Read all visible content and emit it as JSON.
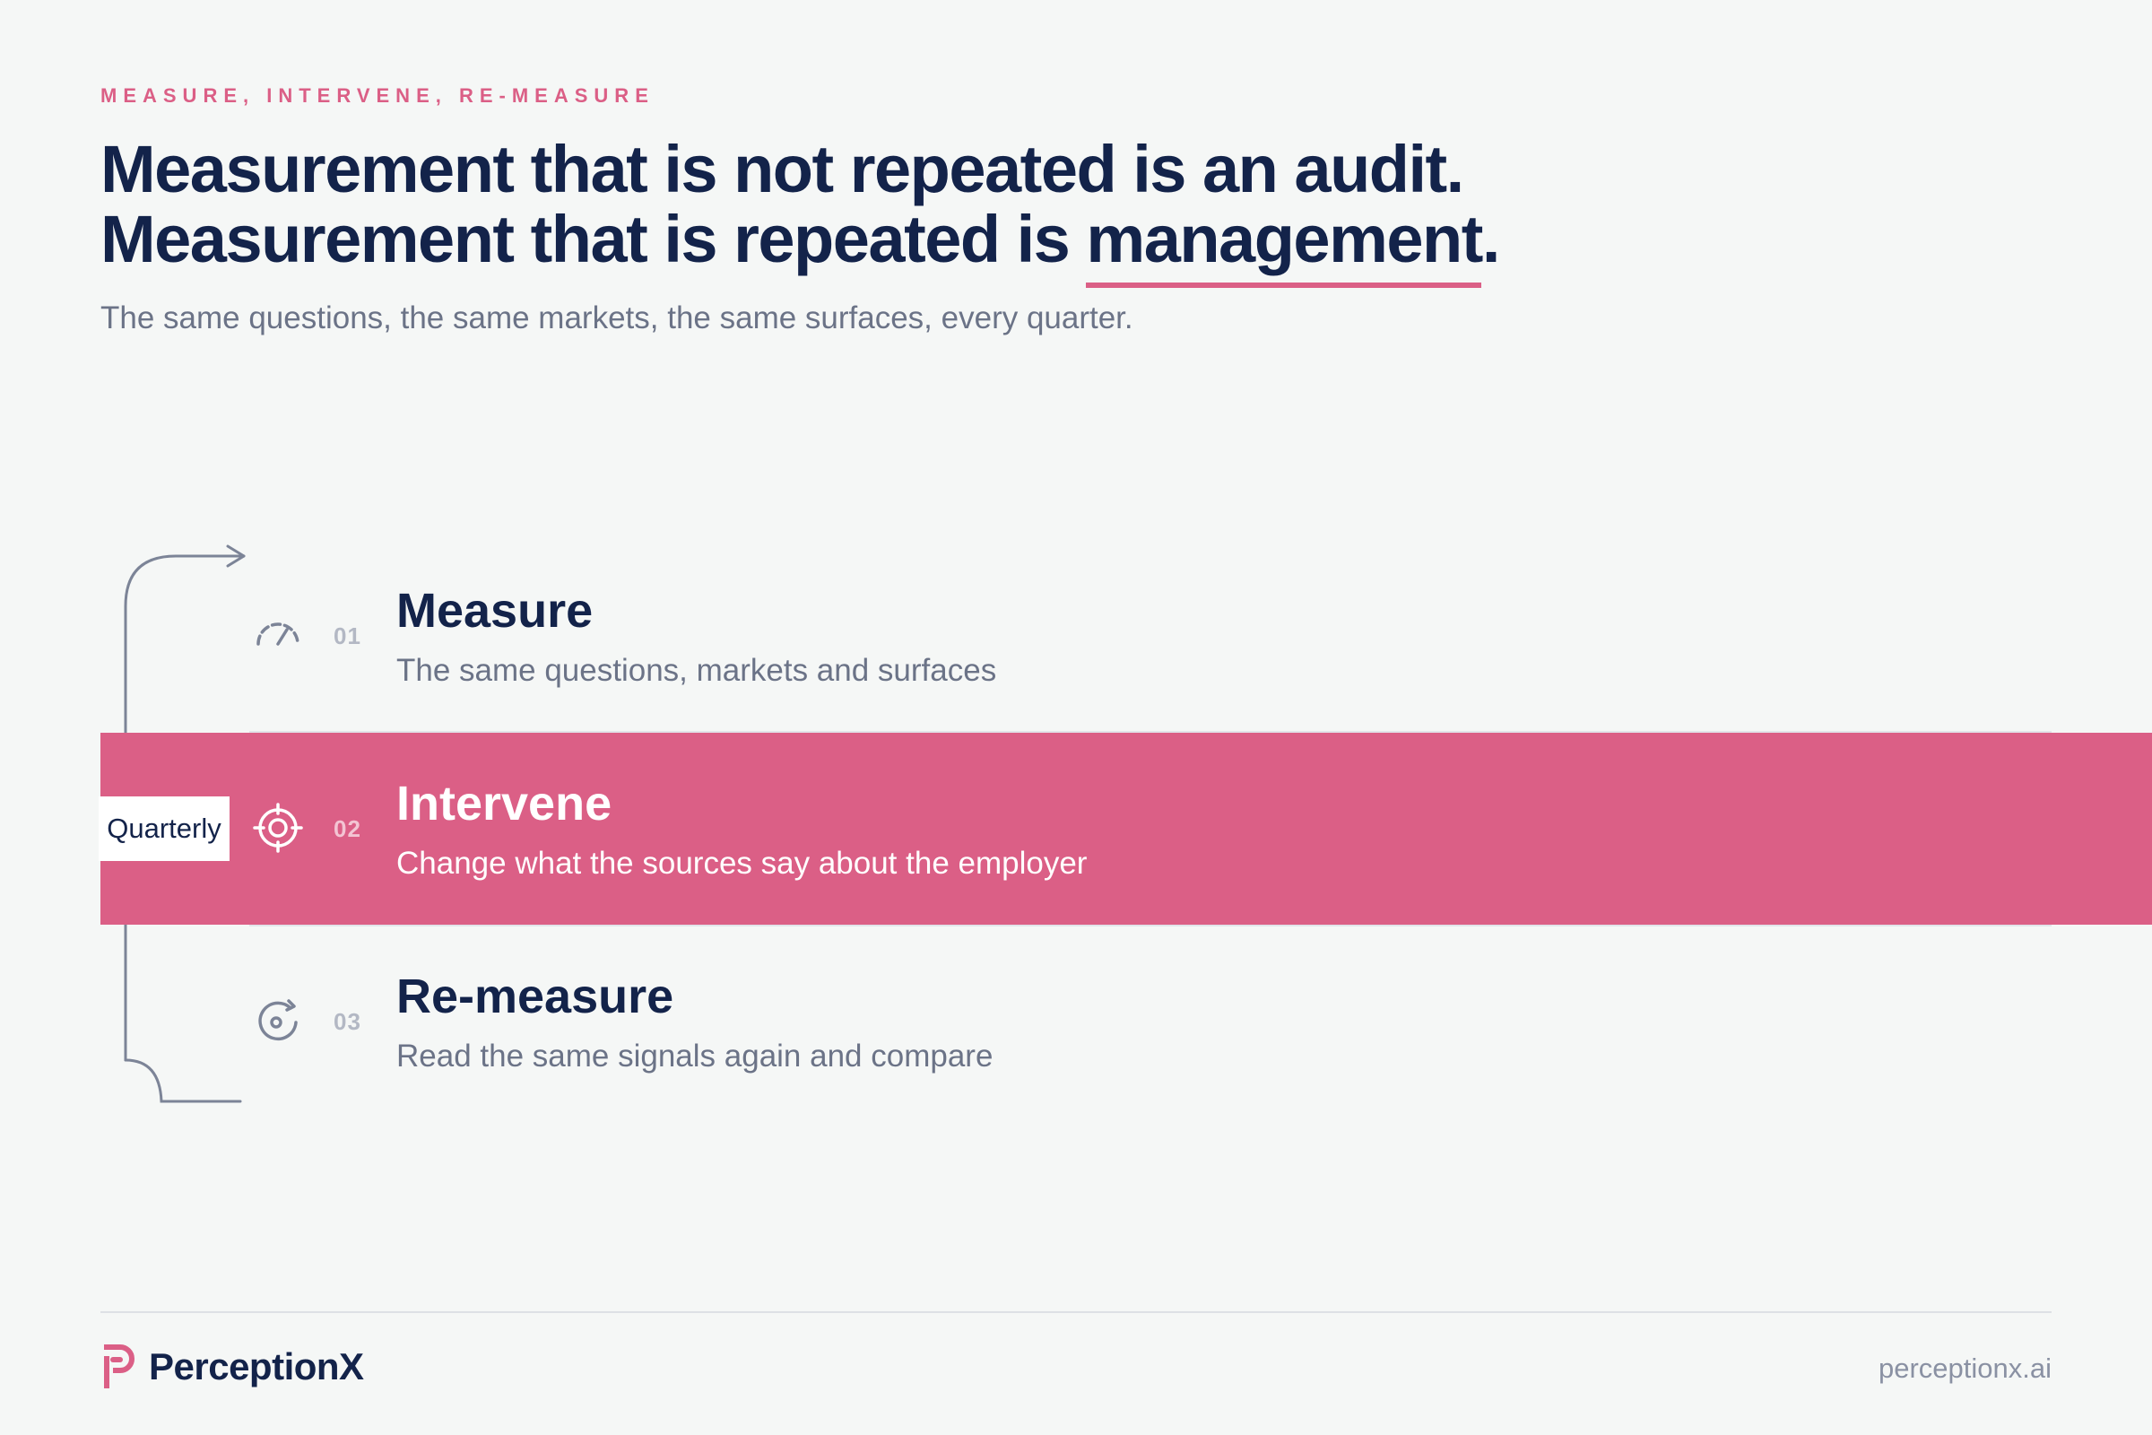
{
  "eyebrow": "MEASURE, INTERVENE, RE-MEASURE",
  "headline": {
    "line1": "Measurement that is not repeated is an audit.",
    "line2_prefix": "Measurement that is repeated is ",
    "line2_highlight": "management.",
    "accent_color": "#db5f86"
  },
  "subhead": "The same questions, the same markets, the same surfaces, every quarter.",
  "cycle_label": "Quarterly",
  "steps": [
    {
      "num": "01",
      "title": "Measure",
      "desc": "The same questions, markets and surfaces",
      "icon": "gauge-icon",
      "active": false
    },
    {
      "num": "02",
      "title": "Intervene",
      "desc": "Change what the sources say about the employer",
      "icon": "target-icon",
      "active": true
    },
    {
      "num": "03",
      "title": "Re-measure",
      "desc": "Read the same signals again and compare",
      "icon": "refresh-icon",
      "active": false
    }
  ],
  "footer": {
    "brand": "PerceptionX",
    "url": "perceptionx.ai"
  },
  "colors": {
    "navy": "#13234a",
    "pink": "#db5f86",
    "muted": "#6b7387",
    "background": "#f5f7f6"
  }
}
